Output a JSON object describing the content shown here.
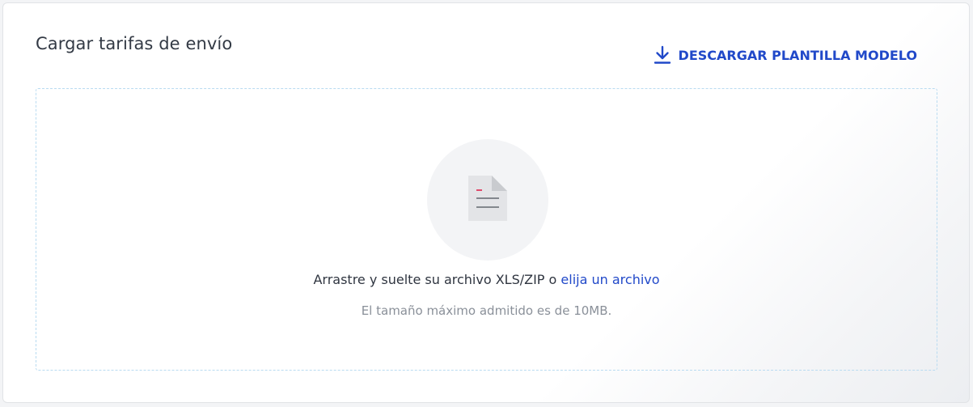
{
  "card": {
    "title": "Cargar tarifas de envío"
  },
  "download": {
    "label": "DESCARGAR PLANTILLA MODELO",
    "icon": "download-icon"
  },
  "dropzone": {
    "icon": "document-icon",
    "instruction_prefix": "Arrastre y suelte su archivo XLS/ZIP o",
    "choose_link": "elija un archivo",
    "size_hint": "El tamaño máximo admitido es de 10MB."
  },
  "colors": {
    "accent": "#2149c9",
    "dropzone_border": "#b9dbf1",
    "muted_text": "#8a9099",
    "icon_mark": "#e0234e"
  }
}
